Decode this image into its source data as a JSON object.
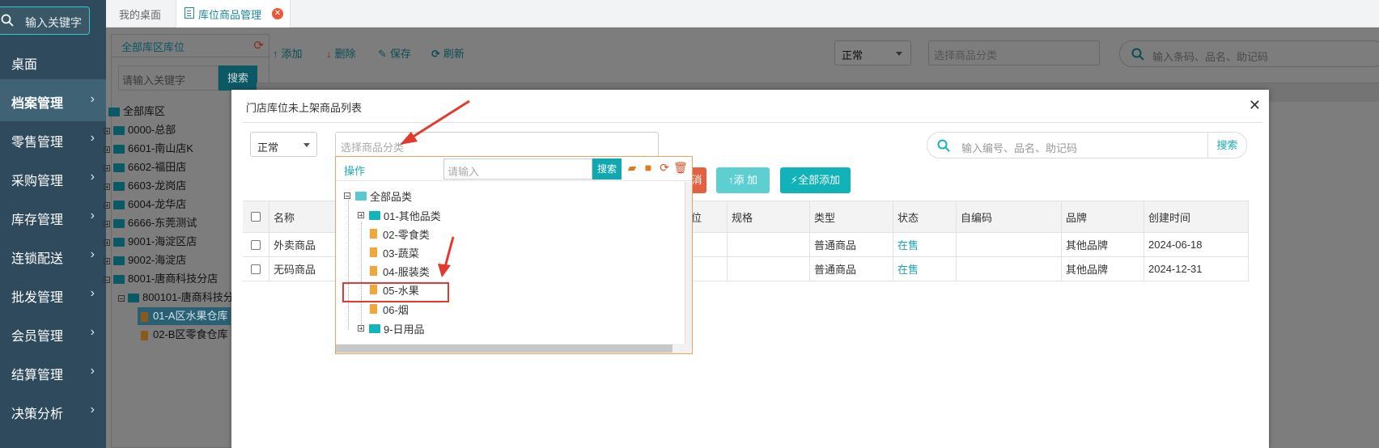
{
  "sidebar": {
    "search_placeholder": "输入关键字",
    "items": [
      {
        "label": "桌面",
        "has_arrow": false
      },
      {
        "label": "档案管理",
        "has_arrow": true,
        "active": true
      },
      {
        "label": "零售管理",
        "has_arrow": true
      },
      {
        "label": "采购管理",
        "has_arrow": true
      },
      {
        "label": "库存管理",
        "has_arrow": true
      },
      {
        "label": "连锁配送",
        "has_arrow": true
      },
      {
        "label": "批发管理",
        "has_arrow": true
      },
      {
        "label": "会员管理",
        "has_arrow": true
      },
      {
        "label": "结算管理",
        "has_arrow": true
      },
      {
        "label": "决策分析",
        "has_arrow": true
      }
    ]
  },
  "tabs": {
    "home": "我的桌面",
    "current": "库位商品管理"
  },
  "left_panel": {
    "title": "全部库区库位",
    "search_placeholder": "请输入关键字",
    "search_button": "搜索",
    "tree": [
      {
        "label": "全部库区",
        "level": 0
      },
      {
        "label": "0000-总部",
        "level": 1
      },
      {
        "label": "6601-南山店K",
        "level": 1
      },
      {
        "label": "6602-福田店",
        "level": 1
      },
      {
        "label": "6603-龙岗店",
        "level": 1
      },
      {
        "label": "6004-龙华店",
        "level": 1
      },
      {
        "label": "6666-东莞测试",
        "level": 1
      },
      {
        "label": "9001-海淀区店",
        "level": 1
      },
      {
        "label": "9002-海淀店",
        "level": 1
      },
      {
        "label": "8001-唐商科技分店",
        "level": 1
      },
      {
        "label": "800101-唐商科技分",
        "level": 2
      },
      {
        "label": "01-A区水果仓库",
        "level": 3,
        "selected": true
      },
      {
        "label": "02-B区零食仓库",
        "level": 3
      }
    ]
  },
  "toolbar": {
    "add": "添加",
    "delete": "删除",
    "save": "保存",
    "refresh": "刷新",
    "status_value": "正常",
    "category_placeholder": "选择商品分类",
    "search_placeholder": "输入条码、品名、助记码"
  },
  "modal": {
    "title": "门店库位未上架商品列表",
    "status_value": "正常",
    "category_placeholder": "选择商品分类",
    "search_placeholder": "输入编号、品名、助记码",
    "search_button": "搜索",
    "btn_partial": "消",
    "btn_add": "添 加",
    "btn_add_all": "全部添加",
    "columns": [
      "名称",
      "位",
      "规格",
      "类型",
      "状态",
      "自编码",
      "品牌",
      "创建时间"
    ],
    "rows": [
      {
        "name": "外卖商品",
        "unit": "",
        "spec": "",
        "type": "普通商品",
        "status": "在售",
        "code": "",
        "brand": "其他品牌",
        "created": "2024-06-18"
      },
      {
        "name": "无码商品",
        "unit": "",
        "spec": "",
        "type": "普通商品",
        "status": "在售",
        "code": "",
        "brand": "其他品牌",
        "created": "2024-12-31"
      }
    ]
  },
  "dropdown": {
    "op_label": "操作",
    "input_placeholder": "请输入",
    "search_button": "搜索",
    "icons": [
      "folder-open-icon",
      "folder-icon",
      "refresh-icon",
      "trash-icon"
    ],
    "tree": [
      {
        "label": "全部品类",
        "level": 0
      },
      {
        "label": "01-其他品类",
        "level": 1,
        "folder": true
      },
      {
        "label": "02-零食类",
        "level": 1
      },
      {
        "label": "03-蔬菜",
        "level": 1
      },
      {
        "label": "04-服装类",
        "level": 1
      },
      {
        "label": "05-水果",
        "level": 1,
        "highlighted": true
      },
      {
        "label": "06-烟",
        "level": 1
      },
      {
        "label": "9-日用品",
        "level": 1,
        "folder": true
      }
    ]
  },
  "colors": {
    "sidebar_bg": "#2e4a5c",
    "accent": "#11b3b8",
    "annotation_red": "#e23a2e"
  }
}
